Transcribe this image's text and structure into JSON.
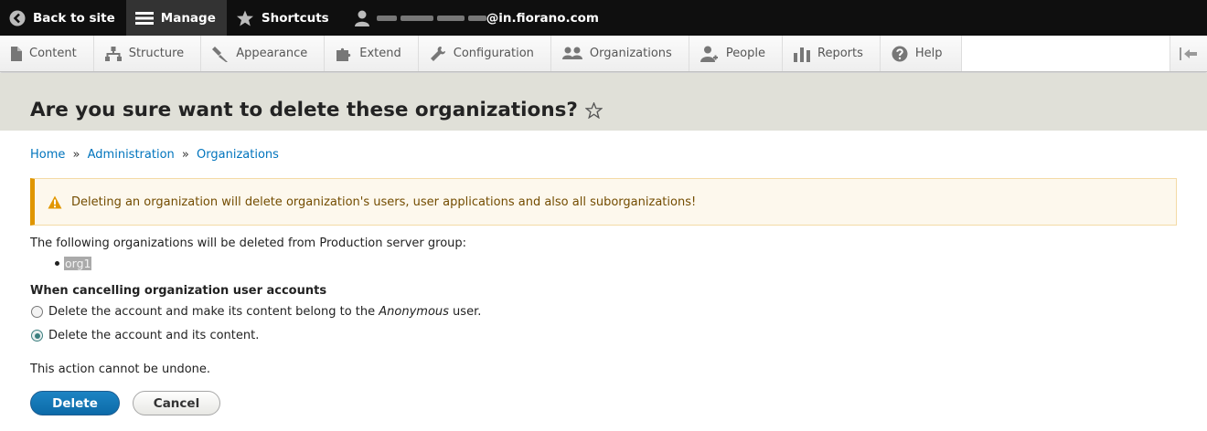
{
  "toolbar": {
    "back_label": "Back to site",
    "manage_label": "Manage",
    "shortcuts_label": "Shortcuts",
    "user_domain": "@in.fiorano.com"
  },
  "tray": {
    "items": [
      {
        "label": "Content",
        "icon": "document-icon"
      },
      {
        "label": "Structure",
        "icon": "sitemap-icon"
      },
      {
        "label": "Appearance",
        "icon": "paintbrush-icon"
      },
      {
        "label": "Extend",
        "icon": "puzzle-icon"
      },
      {
        "label": "Configuration",
        "icon": "wrench-icon"
      },
      {
        "label": "Organizations",
        "icon": "organizations-icon"
      },
      {
        "label": "People",
        "icon": "people-icon"
      },
      {
        "label": "Reports",
        "icon": "bar-chart-icon"
      },
      {
        "label": "Help",
        "icon": "help-icon"
      }
    ]
  },
  "page": {
    "title": "Are you sure want to delete these organizations?"
  },
  "breadcrumb": {
    "home": "Home",
    "sep": "»",
    "admin": "Administration",
    "orgs": "Organizations"
  },
  "warning": {
    "text": "Deleting an organization will delete organization's users, user applications and also all suborganizations!"
  },
  "content": {
    "lead": "The following organizations will be deleted from Production server group:",
    "organizations": [
      "org1"
    ],
    "fieldset_label": "When cancelling organization user accounts",
    "option1_prefix": "Delete the account and make its content belong to the ",
    "option1_em": "Anonymous",
    "option1_suffix": " user.",
    "option2": "Delete the account and its content.",
    "selected_option": 2,
    "note": "This action cannot be undone."
  },
  "actions": {
    "delete": "Delete",
    "cancel": "Cancel"
  },
  "colors": {
    "link": "#0074bd",
    "primary": "#0c6aa8",
    "warning_border": "#e09600"
  }
}
